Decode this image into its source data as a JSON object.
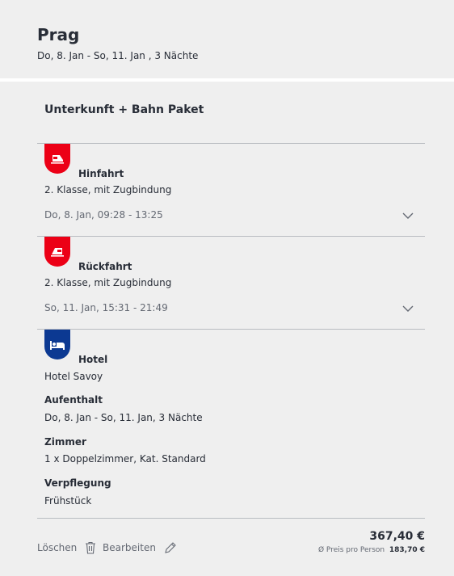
{
  "header": {
    "title": "Prag",
    "subtitle": "Do, 8. Jan - So, 11. Jan , 3 Nächte"
  },
  "package": {
    "title": "Unterkunft + Bahn Paket"
  },
  "segments": [
    {
      "icon": "train-icon",
      "label": "Hinfahrt",
      "detail": "2. Klasse, mit Zugbindung",
      "date": "Do, 8. Jan, 09:28 - 13:25"
    },
    {
      "icon": "train-icon",
      "label": "Rückfahrt",
      "detail": "2. Klasse, mit Zugbindung",
      "date": "So, 11. Jan, 15:31 - 21:49"
    }
  ],
  "hotel": {
    "icon": "bed-icon",
    "label": "Hotel",
    "name": "Hotel Savoy",
    "stay_label": "Aufenthalt",
    "stay_value": "Do, 8. Jan - So, 11. Jan, 3 Nächte",
    "room_label": "Zimmer",
    "room_value": "1 x Doppelzimmer, Kat. Standard",
    "board_label": "Verpflegung",
    "board_value": "Frühstück"
  },
  "footer": {
    "delete_label": "Löschen",
    "edit_label": "Bearbeiten",
    "price": "367,40 €",
    "per_person_label": "Ø Preis pro Person",
    "per_person_value": "183,70 €"
  },
  "colors": {
    "train_badge": "#ec0016",
    "hotel_badge": "#0c3992"
  }
}
